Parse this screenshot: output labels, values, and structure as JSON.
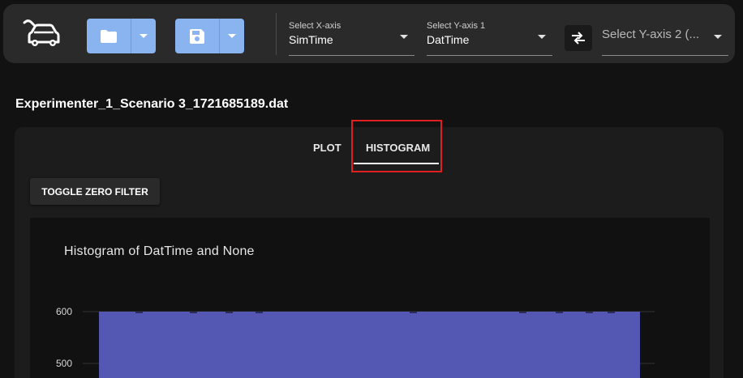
{
  "toolbar": {
    "logo_icon": "car-wrench-icon",
    "open_icon": "folder-icon",
    "save_icon": "save-icon",
    "x_axis": {
      "label": "Select X-axis",
      "value": "SimTime"
    },
    "y_axis1": {
      "label": "Select Y-axis 1",
      "value": "DatTime"
    },
    "swap_icon": "swap-arrows-icon",
    "y_axis2": {
      "placeholder": "Select Y-axis 2 (..."
    }
  },
  "file": {
    "title": "Experimenter_1_Scenario 3_1721685189.dat"
  },
  "tabs": {
    "plot": "PLOT",
    "histogram": "HISTOGRAM",
    "active": "HISTOGRAM"
  },
  "toggle_zero_filter": "TOGGLE ZERO FILTER",
  "colors": {
    "bar": "#5558b2",
    "highlight": "#e02020",
    "button_accent": "#8ab4f0"
  },
  "chart_data": {
    "type": "bar",
    "title": "Histogram of DatTime and None",
    "yticks": [
      600,
      500
    ],
    "series": [
      {
        "values": [
          600
        ]
      }
    ]
  }
}
